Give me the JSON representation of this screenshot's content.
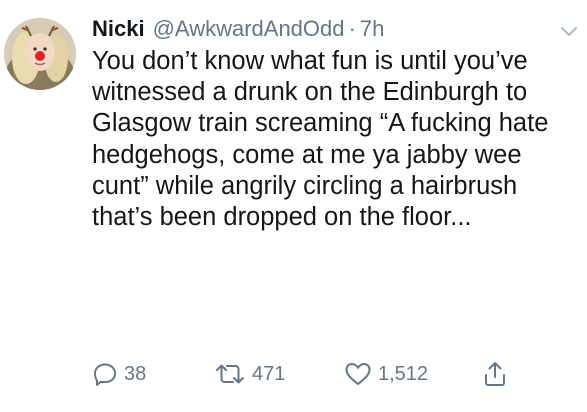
{
  "tweet": {
    "display_name": "Nicki",
    "handle": "@AwkwardAndOdd",
    "separator": "·",
    "time": "7h",
    "text": "You don’t know what fun is until you’ve witnessed a drunk on the Edinburgh to Glasgow train screaming “A fucking hate hedgehogs, come at me ya jabby wee cunt” while angrily circling a hairbrush that’s been dropped on the floor...",
    "avatar_icon": "profile-photo-reindeer-filter",
    "menu_icon": "chevron-down-icon"
  },
  "actions": {
    "reply_count": "38",
    "retweet_count": "471",
    "like_count": "1,512"
  },
  "colors": {
    "text": "#14171a",
    "secondary": "#657786"
  }
}
